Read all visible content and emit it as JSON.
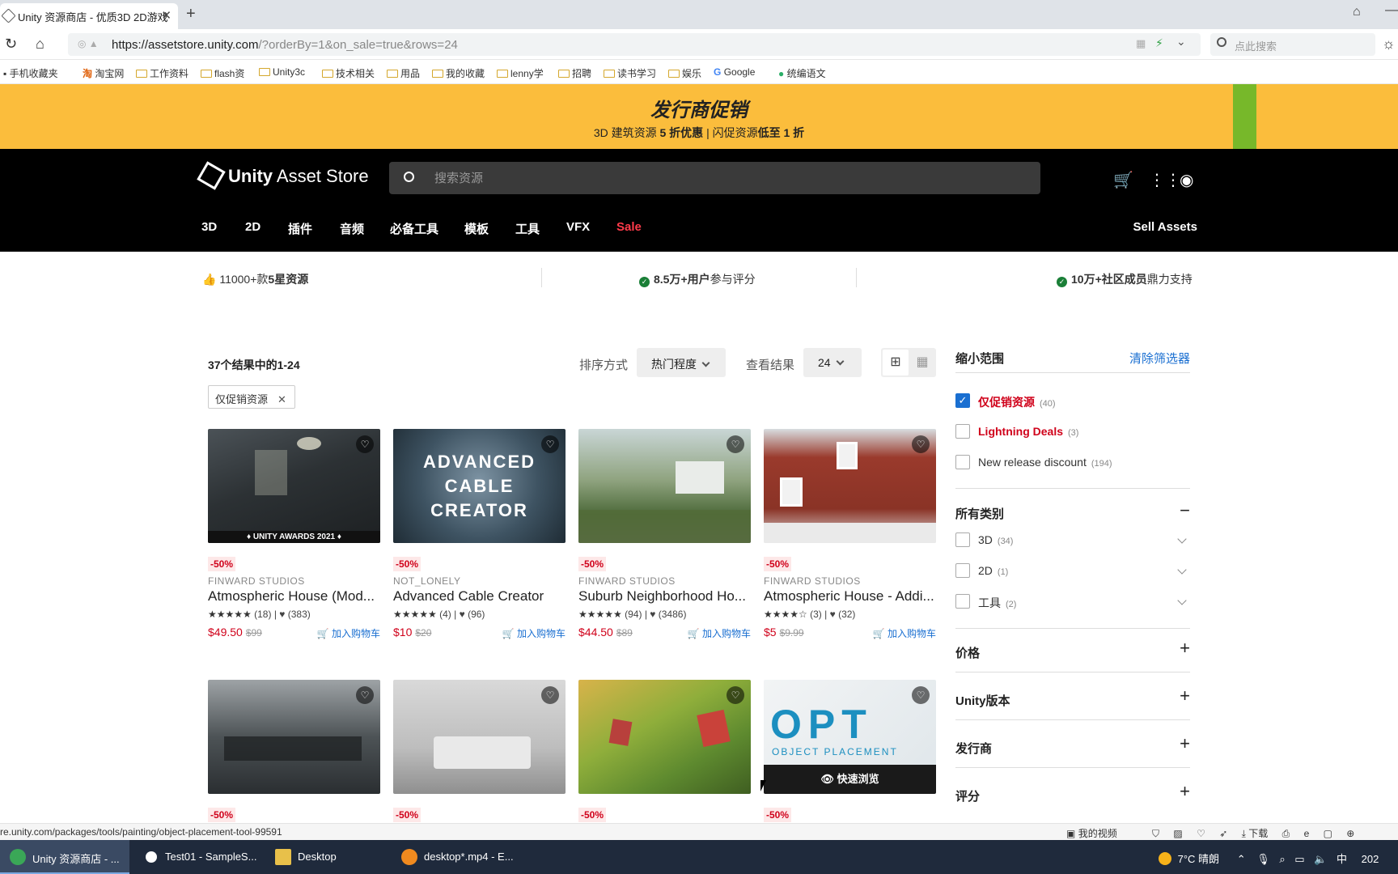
{
  "browser": {
    "tab_title": "Unity 资源商店 - 优质3D 2D游戏",
    "url_host": "https://assetstore.unity.com",
    "url_path": "/?orderBy=1&on_sale=true&rows=24",
    "search_placeholder": "点此搜索",
    "bookmarks": [
      "手机收藏夹",
      "淘宝网",
      "工作资料",
      "flash资",
      "Unity3c",
      "技术相关",
      "用品",
      "我的收藏",
      "lenny学",
      "招聘",
      "读书学习",
      "娱乐",
      "Google",
      "统编语文"
    ]
  },
  "promo": {
    "title": "发行商促销",
    "sub_a": "3D 建筑资源 ",
    "sub_b": "5 折优惠",
    "sub_c": " | 闪促资源",
    "sub_d": "低至 1 折"
  },
  "header": {
    "logo_bold": "Unity",
    "logo_thin": " Asset Store",
    "search_placeholder": "搜索资源",
    "nav": [
      "3D",
      "2D",
      "插件",
      "音频",
      "必备工具",
      "模板",
      "工具",
      "VFX",
      "Sale"
    ],
    "sell": "Sell Assets"
  },
  "stats": {
    "s1_a": "11000+款",
    "s1_b": "5星资源",
    "s2_a": "8.5万+用户",
    "s2_b": "参与评分",
    "s3_a": "10万+社区成员",
    "s3_b": "鼎力支持"
  },
  "results": {
    "count_a": "37个结果中的",
    "count_b": "1-24",
    "sort_label": "排序方式",
    "sort_value": "热门程度",
    "view_label": "查看结果",
    "view_value": "24",
    "chip": "仅促销资源"
  },
  "cards": [
    {
      "badge": "-50%",
      "publisher": "FINWARD STUDIOS",
      "title": "Atmospheric House (Mod...",
      "stars": "★★★★★",
      "reviews": "(18)",
      "favs": "(383)",
      "price": "$49.50",
      "old_price": "$99",
      "cart": "加入购物车",
      "thumb_text": "♦ UNITY AWARDS 2021 ♦"
    },
    {
      "badge": "-50%",
      "publisher": "NOT_LONELY",
      "title": "Advanced Cable Creator",
      "stars": "★★★★★",
      "reviews": "(4)",
      "favs": "(96)",
      "price": "$10",
      "old_price": "$20",
      "cart": "加入购物车",
      "thumb_text": "ADVANCED CABLE CREATOR"
    },
    {
      "badge": "-50%",
      "publisher": "FINWARD STUDIOS",
      "title": "Suburb Neighborhood Ho...",
      "stars": "★★★★★",
      "reviews": "(94)",
      "favs": "(3486)",
      "price": "$44.50",
      "old_price": "$89",
      "cart": "加入购物车",
      "thumb_text": ""
    },
    {
      "badge": "-50%",
      "publisher": "FINWARD STUDIOS",
      "title": "Atmospheric House - Addi...",
      "stars": "★★★★☆",
      "reviews": "(3)",
      "favs": "(32)",
      "price": "$5",
      "old_price": "$9.99",
      "cart": "加入购物车",
      "thumb_text": ""
    }
  ],
  "cards_row2": [
    {
      "badge": "-50%"
    },
    {
      "badge": "-50%"
    },
    {
      "badge": "-50%"
    },
    {
      "badge": "-50%",
      "thumb_text": "OPT",
      "thumb_sub": "OBJECT PLACEMENT",
      "quick": "快速浏览"
    }
  ],
  "sidebar": {
    "title": "缩小范围",
    "clear": "清除筛选器",
    "deals": [
      {
        "label": "仅促销资源",
        "count": "(40)",
        "checked": true
      },
      {
        "label": "Lightning Deals",
        "count": "(3)",
        "checked": false
      },
      {
        "label": "New release discount",
        "count": "(194)",
        "checked": false
      }
    ],
    "categories_title": "所有类别",
    "categories": [
      {
        "label": "3D",
        "count": "(34)"
      },
      {
        "label": "2D",
        "count": "(1)"
      },
      {
        "label": "工具",
        "count": "(2)"
      }
    ],
    "sections": [
      "价格",
      "Unity版本",
      "发行商",
      "评分"
    ]
  },
  "status": {
    "url": "re.unity.com/packages/tools/painting/object-placement-tool-99591",
    "right": "我的视频",
    "download": "下载"
  },
  "taskbar": {
    "tasks": [
      "Unity 资源商店 - ...",
      "Test01 - SampleS...",
      "Desktop",
      "desktop*.mp4 - E..."
    ],
    "weather": "7°C 晴朗",
    "ime": "中",
    "clock": "202"
  }
}
